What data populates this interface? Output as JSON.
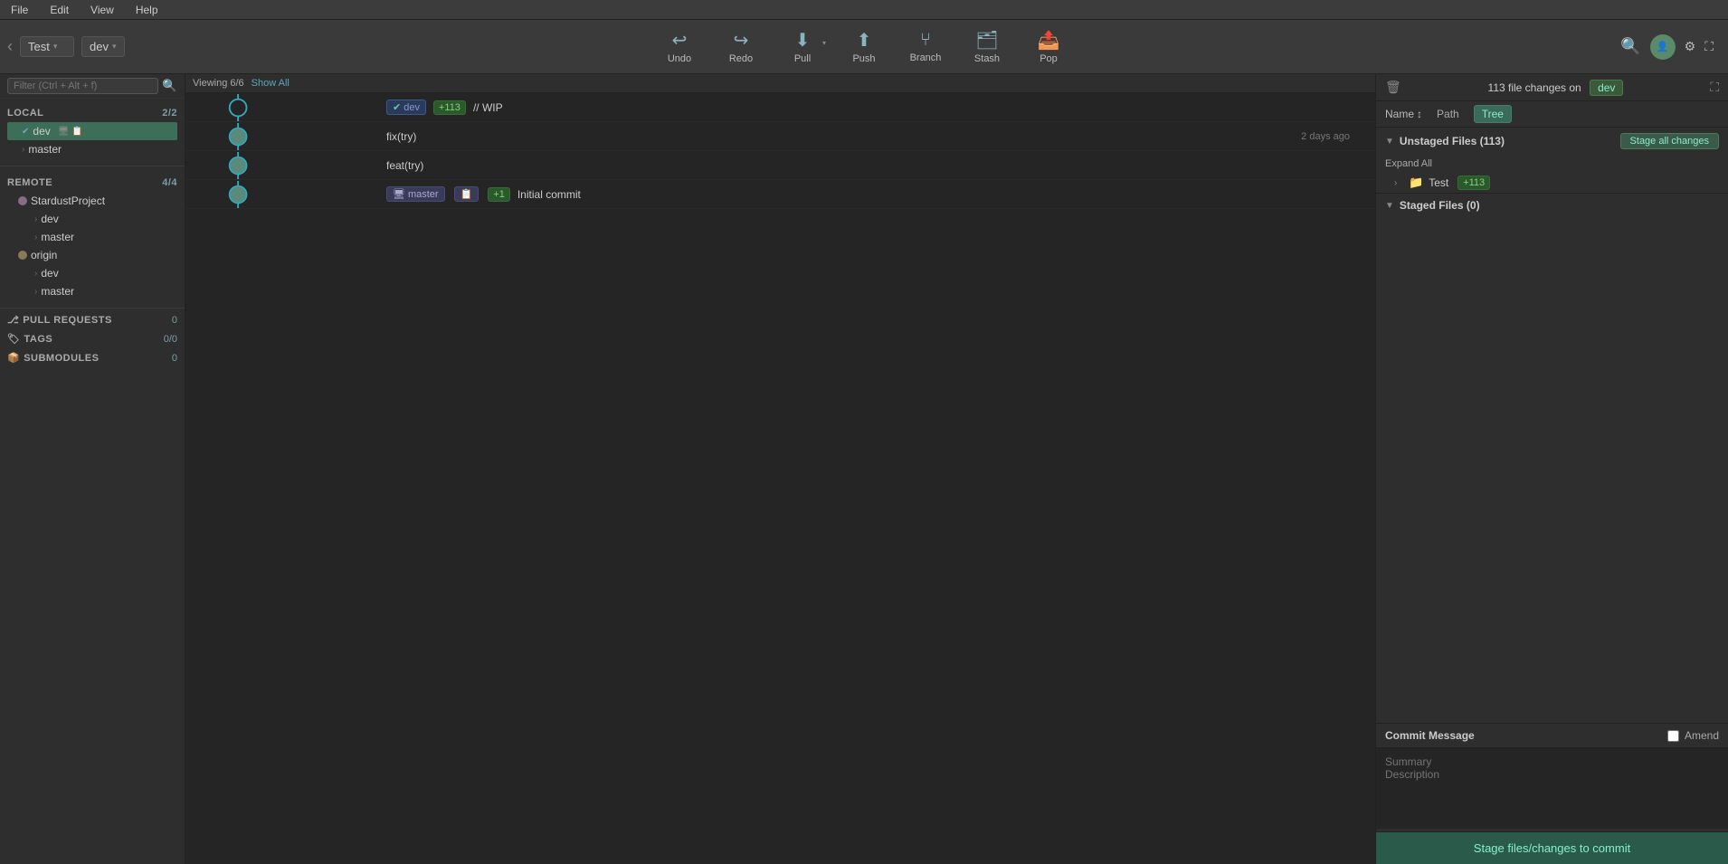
{
  "menubar": {
    "items": [
      "File",
      "Edit",
      "View",
      "Help"
    ]
  },
  "toolbar": {
    "repo_name": "Test",
    "branch_name": "dev",
    "buttons": [
      {
        "id": "undo",
        "label": "Undo",
        "icon": "↩"
      },
      {
        "id": "redo",
        "label": "Redo",
        "icon": "↪"
      },
      {
        "id": "pull",
        "label": "Pull",
        "icon": "⬇"
      },
      {
        "id": "push",
        "label": "Push",
        "icon": "⬆"
      },
      {
        "id": "branch",
        "label": "Branch",
        "icon": "⑂"
      },
      {
        "id": "stash",
        "label": "Stash",
        "icon": "📥"
      },
      {
        "id": "pop",
        "label": "Pop",
        "icon": "📤"
      }
    ]
  },
  "sidebar": {
    "back_btn": "‹",
    "filter_placeholder": "Filter (Ctrl + Alt + f)",
    "local": {
      "label": "LOCAL",
      "count": "2/2",
      "branches": [
        {
          "name": "dev",
          "active": true
        },
        {
          "name": "master",
          "active": false
        }
      ]
    },
    "remote": {
      "label": "REMOTE",
      "count": "4/4",
      "remotes": [
        {
          "name": "StardustProject",
          "branches": [
            "dev",
            "master"
          ]
        },
        {
          "name": "origin",
          "branches": [
            "dev",
            "master"
          ]
        }
      ]
    },
    "pull_requests": {
      "label": "PULL REQUESTS",
      "count": "0"
    },
    "tags": {
      "label": "TAGS",
      "count": "0/0"
    },
    "submodules": {
      "label": "SUBMODULES",
      "count": "0"
    }
  },
  "graph": {
    "viewing_label": "Viewing 6/6",
    "show_all": "Show All",
    "commits": [
      {
        "id": "wip",
        "msg": "// WIP",
        "time": "",
        "branch_tags": [
          {
            "label": "dev",
            "type": "checked"
          },
          {
            "label": "+113",
            "type": "plus"
          }
        ],
        "is_wip": true
      },
      {
        "id": "fix",
        "msg": "fix(try)",
        "time": "2 days ago",
        "branch_tags": [],
        "is_wip": false
      },
      {
        "id": "feat",
        "msg": "feat(try)",
        "time": "",
        "branch_tags": [],
        "is_wip": false
      },
      {
        "id": "initial",
        "msg": "Initial commit",
        "time": "",
        "branch_tags": [
          {
            "label": "master",
            "type": "remote"
          },
          {
            "label": "+1",
            "type": "plus_small"
          }
        ],
        "is_wip": false
      }
    ]
  },
  "right_panel": {
    "file_count_text": "113 file changes on",
    "branch_badge": "dev",
    "name_sort_label": "Name",
    "tabs": [
      {
        "id": "path",
        "label": "Path",
        "active": false
      },
      {
        "id": "tree",
        "label": "Tree",
        "active": true
      }
    ],
    "unstaged": {
      "label": "Unstaged Files (113)",
      "expand_all": "Expand All",
      "stage_all_btn": "Stage all changes",
      "items": [
        {
          "name": "Test",
          "count": 113,
          "type": "folder"
        }
      ]
    },
    "staged": {
      "label": "Staged Files (0)",
      "items": []
    },
    "commit_message": {
      "title": "Commit Message",
      "amend_label": "Amend",
      "summary_placeholder": "Summary",
      "description_placeholder": "Description",
      "stage_btn": "Stage files/changes to commit"
    }
  }
}
